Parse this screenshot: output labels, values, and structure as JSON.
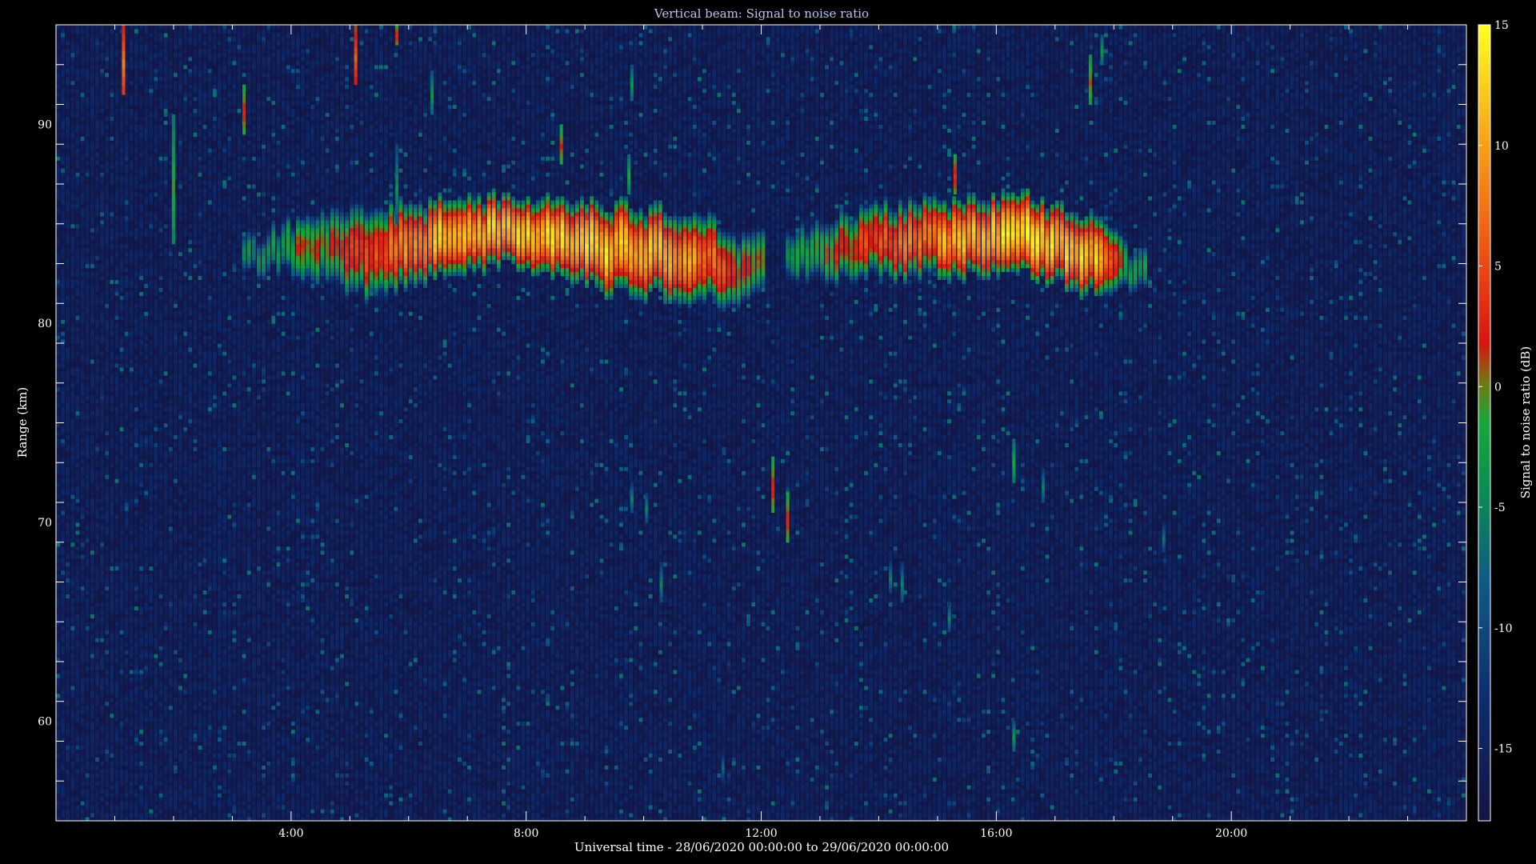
{
  "chart_data": {
    "type": "heatmap",
    "title": "Vertical beam: Signal to noise ratio",
    "xlabel": "Universal time - 28/06/2020 00:00:00 to 29/06/2020 00:00:00",
    "ylabel": "Range (km)",
    "colorbar_label": "Signal to noise ratio (dB)",
    "xlim_hours": [
      0,
      24
    ],
    "ylim_km": [
      55,
      95
    ],
    "color_range_db": [
      -18,
      15
    ],
    "x_ticks": [
      {
        "hour": 4,
        "label": "4:00"
      },
      {
        "hour": 8,
        "label": "8:00"
      },
      {
        "hour": 12,
        "label": "12:00"
      },
      {
        "hour": 16,
        "label": "16:00"
      },
      {
        "hour": 20,
        "label": "20:00"
      }
    ],
    "y_ticks": [
      {
        "km": 60,
        "label": "60"
      },
      {
        "km": 70,
        "label": "70"
      },
      {
        "km": 80,
        "label": "80"
      },
      {
        "km": 90,
        "label": "90"
      }
    ],
    "colorbar_ticks": [
      {
        "db": 15,
        "label": "15"
      },
      {
        "db": 10,
        "label": "10"
      },
      {
        "db": 5,
        "label": "5"
      },
      {
        "db": 0,
        "label": "0"
      },
      {
        "db": -5,
        "label": "-5"
      },
      {
        "db": -10,
        "label": "-10"
      },
      {
        "db": -15,
        "label": "-15"
      }
    ],
    "background_db": -16,
    "echo_layer": [
      {
        "hour": 3.5,
        "center_km": 83.5,
        "half_width_km": 1.2,
        "peak_db": -7
      },
      {
        "hour": 4.2,
        "center_km": 84.0,
        "half_width_km": 1.6,
        "peak_db": -1
      },
      {
        "hour": 5.2,
        "center_km": 83.5,
        "half_width_km": 2.0,
        "peak_db": 3
      },
      {
        "hour": 6.5,
        "center_km": 84.3,
        "half_width_km": 1.6,
        "peak_db": 11
      },
      {
        "hour": 7.8,
        "center_km": 84.6,
        "half_width_km": 1.4,
        "peak_db": 12
      },
      {
        "hour": 9.5,
        "center_km": 83.8,
        "half_width_km": 1.8,
        "peak_db": 12
      },
      {
        "hour": 11.0,
        "center_km": 83.3,
        "half_width_km": 1.8,
        "peak_db": 8
      },
      {
        "hour": 11.8,
        "center_km": 82.7,
        "half_width_km": 1.6,
        "peak_db": 0
      },
      {
        "hour": 12.5,
        "center_km": 83.5,
        "half_width_km": 1.4,
        "peak_db": -6
      },
      {
        "hour": 13.5,
        "center_km": 84.0,
        "half_width_km": 1.6,
        "peak_db": 2
      },
      {
        "hour": 15.0,
        "center_km": 84.3,
        "half_width_km": 1.6,
        "peak_db": 9
      },
      {
        "hour": 16.5,
        "center_km": 84.5,
        "half_width_km": 1.6,
        "peak_db": 13
      },
      {
        "hour": 17.8,
        "center_km": 83.2,
        "half_width_km": 1.6,
        "peak_db": 11
      },
      {
        "hour": 18.3,
        "center_km": 82.8,
        "half_width_km": 1.2,
        "peak_db": -6
      }
    ],
    "echo_gaps_hours": [
      [
        12.1,
        12.45
      ]
    ],
    "streaks": [
      {
        "hour": 1.15,
        "km_top": 95.0,
        "km_bottom": 91.5,
        "db": 8
      },
      {
        "hour": 2.0,
        "km_top": 90.5,
        "km_bottom": 84.0,
        "db": -2
      },
      {
        "hour": 3.2,
        "km_top": 92.0,
        "km_bottom": 89.5,
        "db": 2
      },
      {
        "hour": 5.1,
        "km_top": 95.0,
        "km_bottom": 92.0,
        "db": 6
      },
      {
        "hour": 5.8,
        "km_top": 95.0,
        "km_bottom": 94.0,
        "db": 3
      },
      {
        "hour": 6.4,
        "km_top": 92.7,
        "km_bottom": 90.5,
        "db": -5
      },
      {
        "hour": 8.6,
        "km_top": 90.0,
        "km_bottom": 88.0,
        "db": 1
      },
      {
        "hour": 9.8,
        "km_top": 93.0,
        "km_bottom": 91.2,
        "db": -5
      },
      {
        "hour": 9.75,
        "km_top": 88.5,
        "km_bottom": 86.5,
        "db": -3
      },
      {
        "hour": 12.2,
        "km_top": 73.3,
        "km_bottom": 70.5,
        "db": 2
      },
      {
        "hour": 12.45,
        "km_top": 71.5,
        "km_bottom": 69.0,
        "db": 2
      },
      {
        "hour": 15.3,
        "km_top": 88.5,
        "km_bottom": 86.5,
        "db": 3
      },
      {
        "hour": 16.3,
        "km_top": 74.2,
        "km_bottom": 72.0,
        "db": -3
      },
      {
        "hour": 16.3,
        "km_top": 60.0,
        "km_bottom": 58.5,
        "db": -5
      },
      {
        "hour": 16.8,
        "km_top": 72.7,
        "km_bottom": 71.0,
        "db": -7
      },
      {
        "hour": 17.6,
        "km_top": 93.5,
        "km_bottom": 91.0,
        "db": 0
      },
      {
        "hour": 17.8,
        "km_top": 94.5,
        "km_bottom": 93.0,
        "db": -5
      },
      {
        "hour": 9.8,
        "km_top": 72.0,
        "km_bottom": 70.5,
        "db": -7
      },
      {
        "hour": 10.05,
        "km_top": 71.5,
        "km_bottom": 70.0,
        "db": -7
      },
      {
        "hour": 10.3,
        "km_top": 68.0,
        "km_bottom": 66.0,
        "db": -7
      },
      {
        "hour": 14.2,
        "km_top": 68.0,
        "km_bottom": 66.5,
        "db": -7
      },
      {
        "hour": 14.4,
        "km_top": 68.0,
        "km_bottom": 66.0,
        "db": -7
      },
      {
        "hour": 15.2,
        "km_top": 66.0,
        "km_bottom": 64.5,
        "db": -7
      },
      {
        "hour": 18.85,
        "km_top": 70.0,
        "km_bottom": 68.5,
        "db": -8
      },
      {
        "hour": 11.35,
        "km_top": 58.5,
        "km_bottom": 57.0,
        "db": -9
      },
      {
        "hour": 5.8,
        "km_top": 89.0,
        "km_bottom": 85.0,
        "db": -6
      }
    ]
  }
}
